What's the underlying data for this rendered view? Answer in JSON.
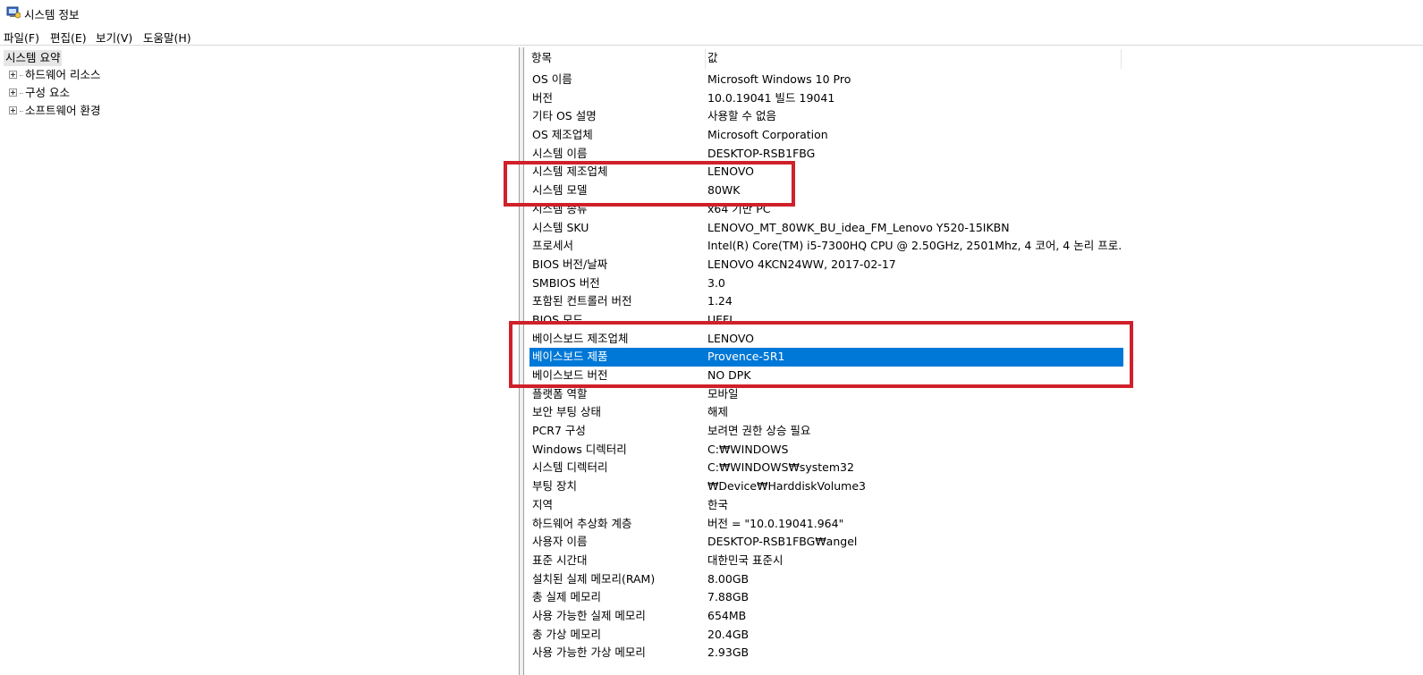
{
  "window": {
    "title": "시스템 정보",
    "icon": "system-info-icon"
  },
  "menu": {
    "file": "파일(F)",
    "edit": "편집(E)",
    "view": "보기(V)",
    "help": "도움말(H)"
  },
  "tree": {
    "root": "시스템 요약",
    "items": [
      {
        "label": "하드웨어 리소스"
      },
      {
        "label": "구성 요소"
      },
      {
        "label": "소프트웨어 환경"
      }
    ]
  },
  "table": {
    "col_item": "항목",
    "col_value": "값",
    "rows": [
      {
        "item": "OS 이름",
        "value": "Microsoft Windows 10 Pro"
      },
      {
        "item": "버전",
        "value": "10.0.19041 빌드 19041"
      },
      {
        "item": "기타 OS 설명",
        "value": "사용할 수 없음"
      },
      {
        "item": "OS 제조업체",
        "value": "Microsoft Corporation"
      },
      {
        "item": "시스템 이름",
        "value": "DESKTOP-RSB1FBG"
      },
      {
        "item": "시스템 제조업체",
        "value": "LENOVO"
      },
      {
        "item": "시스템 모델",
        "value": "80WK"
      },
      {
        "item": "시스템 종류",
        "value": "x64 기반 PC"
      },
      {
        "item": "시스템 SKU",
        "value": "LENOVO_MT_80WK_BU_idea_FM_Lenovo Y520-15IKBN"
      },
      {
        "item": "프로세서",
        "value": "Intel(R) Core(TM) i5-7300HQ CPU @ 2.50GHz, 2501Mhz, 4 코어, 4 논리 프로..."
      },
      {
        "item": "BIOS 버전/날짜",
        "value": "LENOVO 4KCN24WW, 2017-02-17"
      },
      {
        "item": "SMBIOS 버전",
        "value": "3.0"
      },
      {
        "item": "포함된 컨트롤러 버전",
        "value": "1.24"
      },
      {
        "item": "BIOS 모드",
        "value": "UEFI"
      },
      {
        "item": "베이스보드 제조업체",
        "value": "LENOVO"
      },
      {
        "item": "베이스보드 제품",
        "value": "Provence-5R1",
        "selected": true
      },
      {
        "item": "베이스보드 버전",
        "value": "NO DPK"
      },
      {
        "item": "플랫폼 역할",
        "value": "모바일"
      },
      {
        "item": "보안 부팅 상태",
        "value": "해제"
      },
      {
        "item": "PCR7 구성",
        "value": "보려면 권한 상승 필요"
      },
      {
        "item": "Windows 디렉터리",
        "value": "C:₩WINDOWS"
      },
      {
        "item": "시스템 디렉터리",
        "value": "C:₩WINDOWS₩system32"
      },
      {
        "item": "부팅 장치",
        "value": "₩Device₩HarddiskVolume3"
      },
      {
        "item": "지역",
        "value": "한국"
      },
      {
        "item": "하드웨어 추상화 계층",
        "value": "버전 = \"10.0.19041.964\""
      },
      {
        "item": "사용자 이름",
        "value": "DESKTOP-RSB1FBG₩angel"
      },
      {
        "item": "표준 시간대",
        "value": "대한민국 표준시"
      },
      {
        "item": "설치된 실제 메모리(RAM)",
        "value": "8.00GB"
      },
      {
        "item": "총 실제 메모리",
        "value": "7.88GB"
      },
      {
        "item": "사용 가능한 실제 메모리",
        "value": "654MB"
      },
      {
        "item": "총 가상 메모리",
        "value": "20.4GB"
      },
      {
        "item": "사용 가능한 가상 메모리",
        "value": "2.93GB"
      }
    ]
  },
  "colors": {
    "selection": "#0078d7",
    "annotation_box": "#d0202a"
  }
}
